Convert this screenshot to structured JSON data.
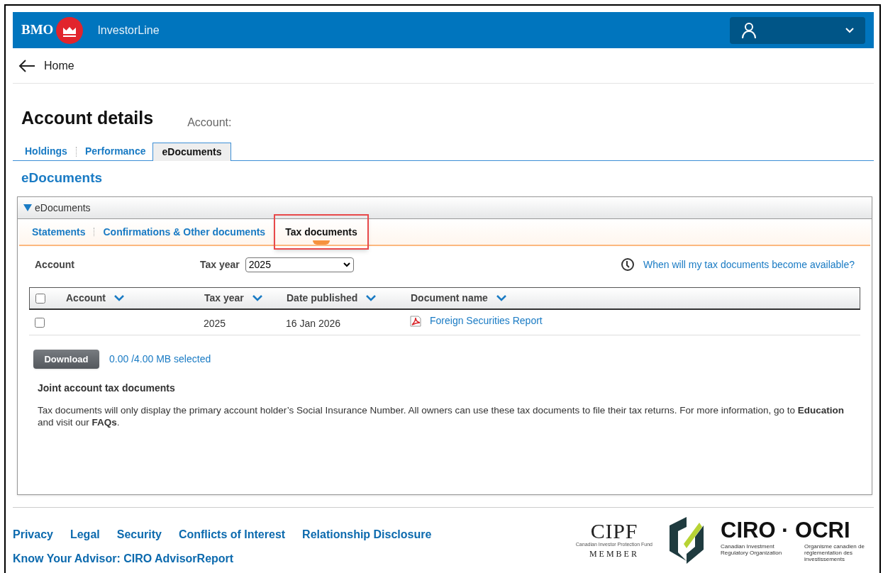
{
  "header": {
    "logo_text": "BMO",
    "product": "InvestorLine"
  },
  "nav": {
    "back_label": "Home"
  },
  "page": {
    "title": "Account details",
    "account_label": "Account:"
  },
  "tabs": [
    {
      "label": "Holdings",
      "selected": false
    },
    {
      "label": "Performance",
      "selected": false
    },
    {
      "label": "eDocuments",
      "selected": true
    }
  ],
  "section_title": "eDocuments",
  "panel": {
    "title": "eDocuments",
    "expanded": true,
    "subtabs": [
      {
        "label": "Statements",
        "selected": false,
        "highlighted": false
      },
      {
        "label": "Confirmations & Other documents",
        "selected": false,
        "highlighted": false
      },
      {
        "label": "Tax documents",
        "selected": true,
        "highlighted": true
      }
    ],
    "filters": {
      "account_label": "Account",
      "tax_year_label": "Tax year",
      "tax_year_value": "2025",
      "help_link": "When will my tax documents become available?"
    },
    "table": {
      "select_all_checked": false,
      "columns": [
        "Account",
        "Tax year",
        "Date published",
        "Document name"
      ],
      "rows": [
        {
          "checked": false,
          "account": "",
          "tax_year": "2025",
          "date_published": "16 Jan 2026",
          "document_name": "Foreign Securities Report"
        }
      ]
    },
    "download_button": "Download",
    "selection_size": "0.00 /4.00 MB selected",
    "note_title": "Joint account tax documents",
    "note_text": "Tax documents will only display the primary account holder’s Social Insurance Number. All owners can use these tax documents to file their tax returns. For more information, go to **Education** and visit our **FAQs**."
  },
  "footer": {
    "links": [
      "Privacy",
      "Legal",
      "Security",
      "Conflicts of Interest",
      "Relationship Disclosure"
    ],
    "links_second_row": [
      "Know Your Advisor: CIRO AdvisorReport"
    ],
    "cipf": {
      "name": "CIPF",
      "subtitle": "Canadian Investor Protection Fund",
      "member": "MEMBER"
    },
    "ciro": {
      "name": "CIRO · OCRI",
      "english": "Canadian Investment Regulatory Organization",
      "french": "Organisme canadien de réglementation des investissements"
    }
  }
}
